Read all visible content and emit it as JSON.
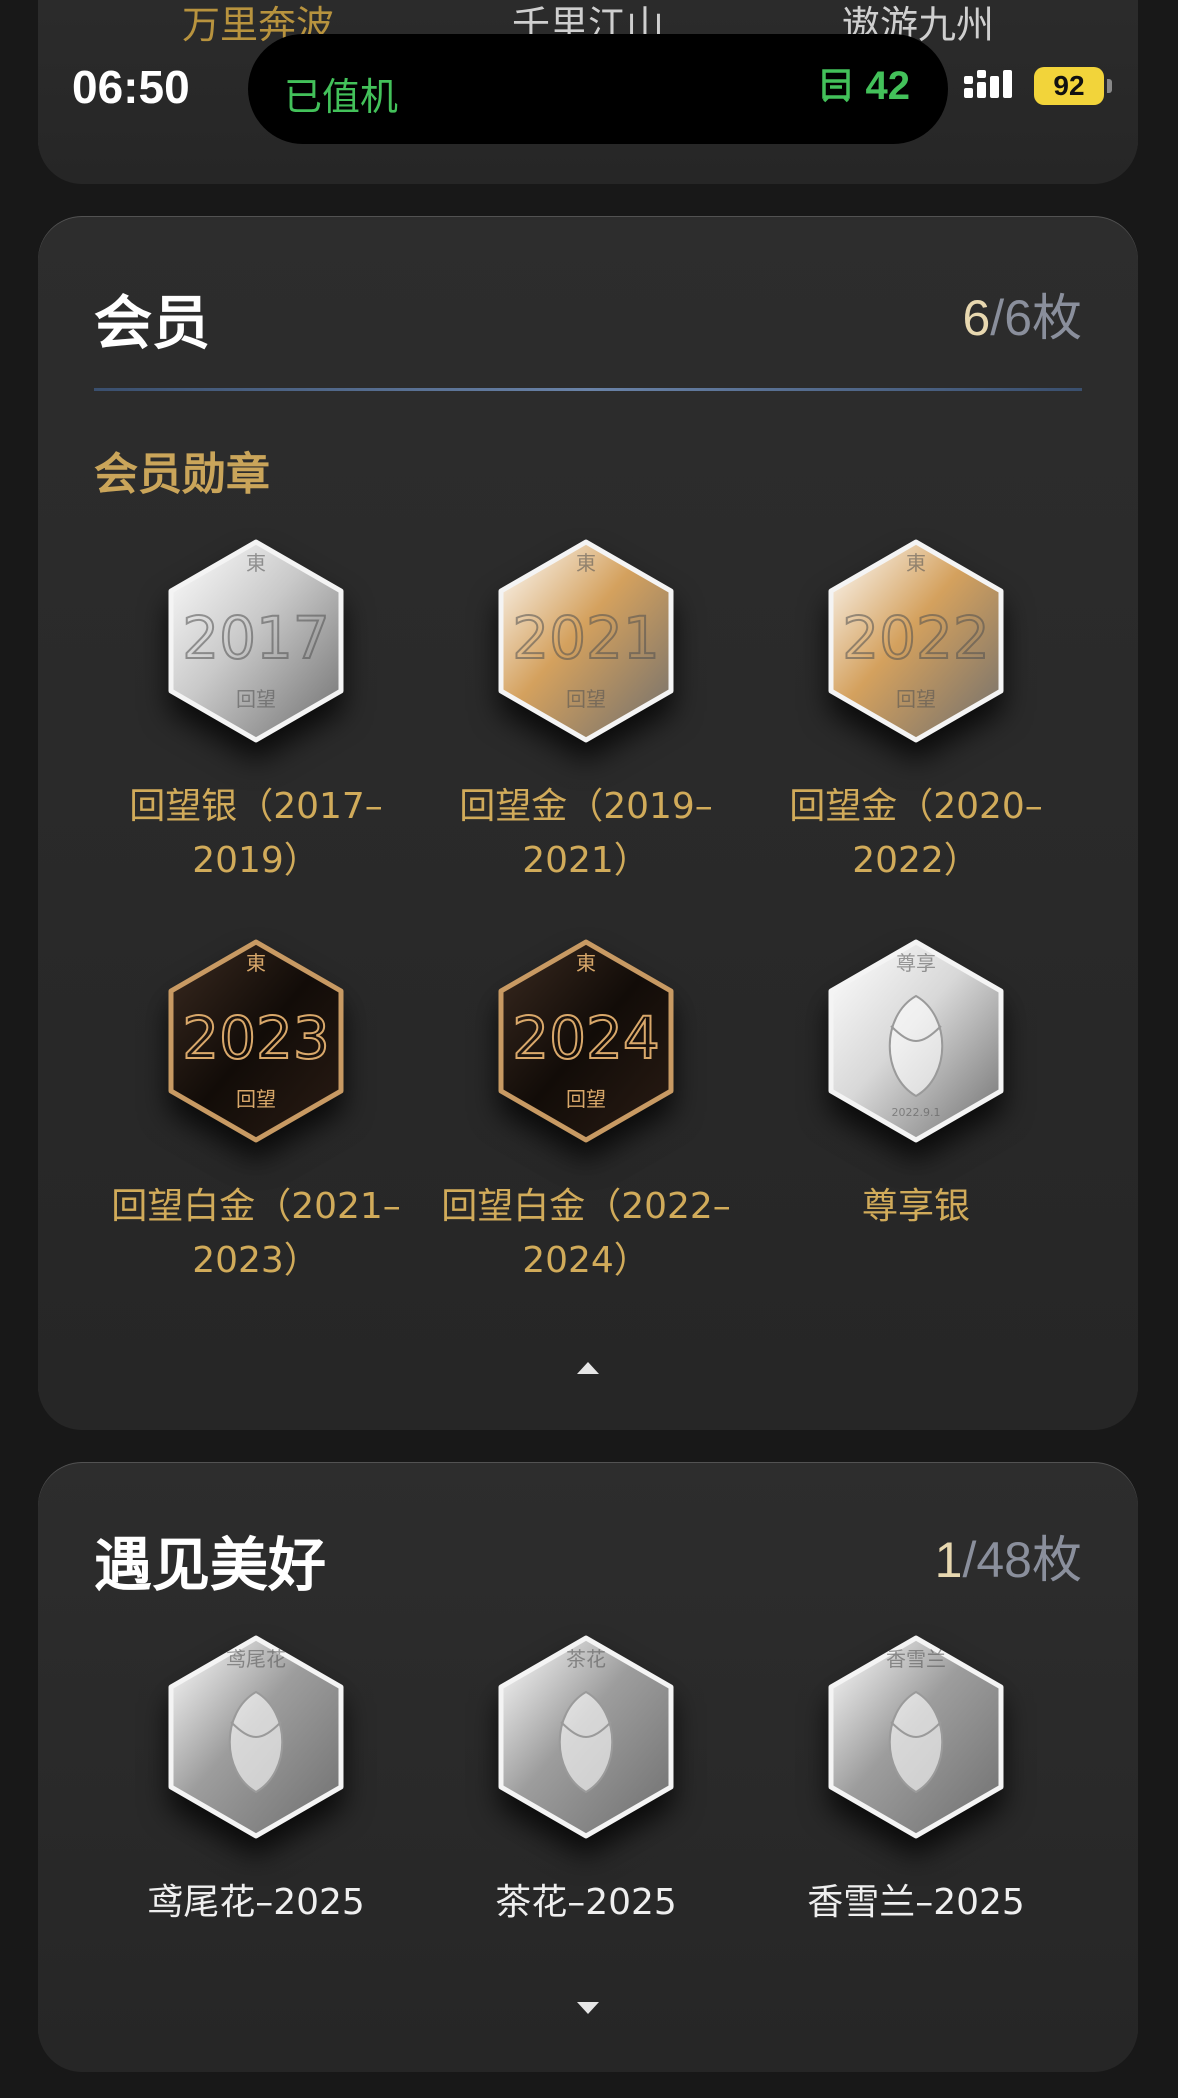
{
  "top_tabs": [
    "万里奔波",
    "千里江山",
    "遨游九州"
  ],
  "status_bar": {
    "time": "06:50",
    "activity_label": "已值机",
    "activity_value": "42",
    "battery": "92"
  },
  "member": {
    "title": "会员",
    "count_have": "6",
    "count_total": "/6枚",
    "section_label": "会员勋章",
    "badges": [
      {
        "line1": "回望银（2017–",
        "line2": "2019）",
        "icon": "silver-2017-badge-icon",
        "color": "#c9c9c9"
      },
      {
        "line1": "回望金（2019–",
        "line2": "2021）",
        "icon": "gold-2019-badge-icon",
        "color": "#d4a15e"
      },
      {
        "line1": "回望金（2020–",
        "line2": "2022）",
        "icon": "gold-2020-badge-icon",
        "color": "#d4a15e"
      },
      {
        "line1": "回望白金（2021–",
        "line2": "2023）",
        "icon": "platinum-2021-badge-icon",
        "color": "#2a1c14"
      },
      {
        "line1": "回望白金（2022–",
        "line2": "2024）",
        "icon": "platinum-2022-badge-icon",
        "color": "#2a1c14"
      },
      {
        "line1": "尊享银",
        "line2": "",
        "icon": "exclusive-silver-badge-icon",
        "color": "#d8d8d8"
      }
    ],
    "badge_glyphs": [
      {
        "top": "東",
        "mid": "2017",
        "bottom": "回望"
      },
      {
        "top": "東",
        "mid": "2021",
        "bottom": "回望"
      },
      {
        "top": "東",
        "mid": "2022",
        "bottom": "回望"
      },
      {
        "top": "東",
        "mid": "2023",
        "bottom": "回望"
      },
      {
        "top": "東",
        "mid": "2024",
        "bottom": "回望"
      },
      {
        "top": "尊享",
        "mid": "",
        "bottom": "2022.9.1"
      }
    ]
  },
  "meet": {
    "title": "遇见美好",
    "count_have": "1",
    "count_total": "/48枚",
    "badges": [
      {
        "label": "鸢尾花–2025",
        "glyph": "鸢尾花",
        "icon": "iris-flower-badge-icon"
      },
      {
        "label": "茶花–2025",
        "glyph": "茶花",
        "icon": "camellia-badge-icon"
      },
      {
        "label": "香雪兰–2025",
        "glyph": "香雪兰",
        "icon": "freesia-badge-icon"
      }
    ]
  },
  "colors": {
    "gold_text": "#d1ab5a",
    "activity_green": "#43c15a",
    "battery_yellow": "#f2d43a"
  }
}
